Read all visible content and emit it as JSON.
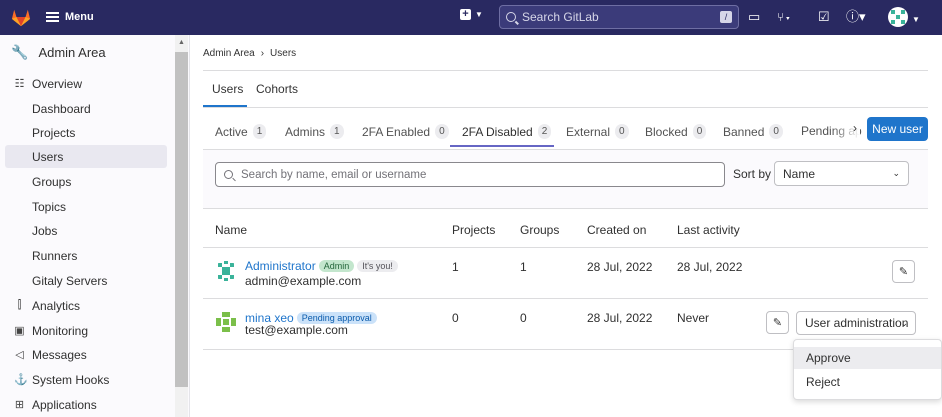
{
  "topbar": {
    "menu_label": "Menu",
    "search_placeholder": "Search GitLab",
    "search_shortcut": "/"
  },
  "sidebar": {
    "header": "Admin Area",
    "items": [
      {
        "label": "Overview",
        "icon": "overview-icon",
        "top": true
      },
      {
        "label": "Dashboard"
      },
      {
        "label": "Projects"
      },
      {
        "label": "Users",
        "active": true
      },
      {
        "label": "Groups"
      },
      {
        "label": "Topics"
      },
      {
        "label": "Jobs"
      },
      {
        "label": "Runners"
      },
      {
        "label": "Gitaly Servers"
      },
      {
        "label": "Analytics",
        "icon": "analytics-icon",
        "top": true
      },
      {
        "label": "Monitoring",
        "icon": "monitoring-icon",
        "top": true
      },
      {
        "label": "Messages",
        "icon": "messages-icon",
        "top": true
      },
      {
        "label": "System Hooks",
        "icon": "hook-icon",
        "top": true
      },
      {
        "label": "Applications",
        "icon": "applications-icon",
        "top": true
      }
    ]
  },
  "breadcrumb": [
    "Admin Area",
    "Users"
  ],
  "subtabs": [
    "Users",
    "Cohorts"
  ],
  "tabs": [
    {
      "label": "Active",
      "count": "1"
    },
    {
      "label": "Admins",
      "count": "1"
    },
    {
      "label": "2FA Enabled",
      "count": "0"
    },
    {
      "label": "2FA Disabled",
      "count": "2",
      "active": true
    },
    {
      "label": "External",
      "count": "0"
    },
    {
      "label": "Blocked",
      "count": "0"
    },
    {
      "label": "Banned",
      "count": "0"
    },
    {
      "label": "Pending ap",
      "count": ""
    }
  ],
  "new_user_label": "New user",
  "search_placeholder": "Search by name, email or username",
  "sort": {
    "label": "Sort by",
    "value": "Name"
  },
  "table": {
    "headers": [
      "Name",
      "Projects",
      "Groups",
      "Created on",
      "Last activity"
    ],
    "rows": [
      {
        "name": "Administrator",
        "email": "admin@example.com",
        "badges": [
          "Admin",
          "It's you!"
        ],
        "projects": "1",
        "groups": "1",
        "created": "28 Jul, 2022",
        "last_activity": "28 Jul, 2022"
      },
      {
        "name": "mina xeo",
        "email": "test@example.com",
        "badges": [
          "Pending approval"
        ],
        "projects": "0",
        "groups": "0",
        "created": "28 Jul, 2022",
        "last_activity": "Never"
      }
    ]
  },
  "user_admin_label": "User administration",
  "dropdown_items": [
    "Approve",
    "Reject"
  ],
  "colors": {
    "topbar": "#292961",
    "primary": "#1f75cb",
    "active_tab": "#6666c4"
  }
}
